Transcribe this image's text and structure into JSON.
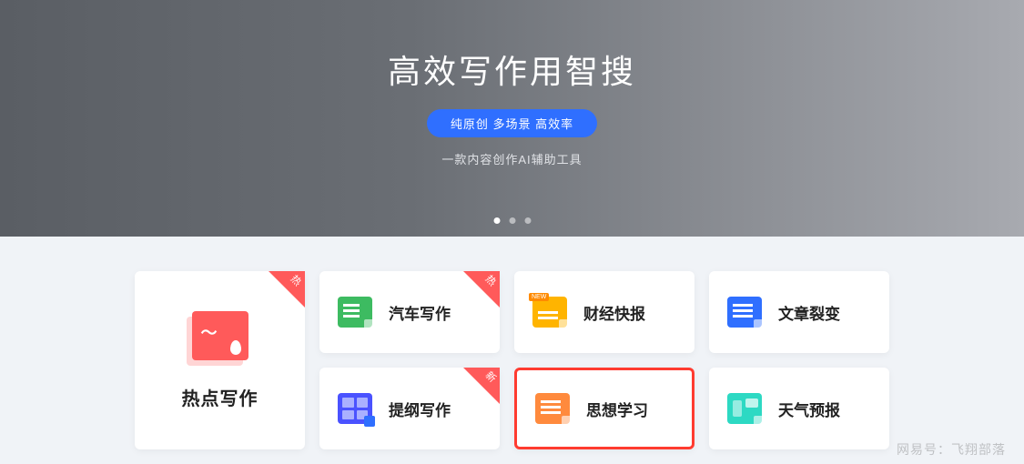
{
  "hero": {
    "title": "高效写作用智搜",
    "badge": "纯原创 多场景 高效率",
    "subtitle": "一款内容创作AI辅助工具"
  },
  "featured": {
    "label": "热点写作",
    "corner_tag": "热"
  },
  "cards": [
    {
      "label": "汽车写作",
      "icon": "green",
      "corner_tag": "热",
      "new_badge": null
    },
    {
      "label": "财经快报",
      "icon": "yellow",
      "corner_tag": null,
      "new_badge": "NEW"
    },
    {
      "label": "文章裂变",
      "icon": "blue",
      "corner_tag": null,
      "new_badge": null
    },
    {
      "label": "提纲写作",
      "icon": "purple",
      "corner_tag": "新",
      "new_badge": null
    },
    {
      "label": "思想学习",
      "icon": "orange",
      "corner_tag": null,
      "new_badge": null,
      "highlight": true
    },
    {
      "label": "天气预报",
      "icon": "teal",
      "corner_tag": null,
      "new_badge": null
    }
  ],
  "watermark": "网易号：飞翔部落",
  "colors": {
    "accent_blue": "#2f6fff",
    "accent_red": "#ff5a5a",
    "highlight_border": "#ff3b30"
  }
}
